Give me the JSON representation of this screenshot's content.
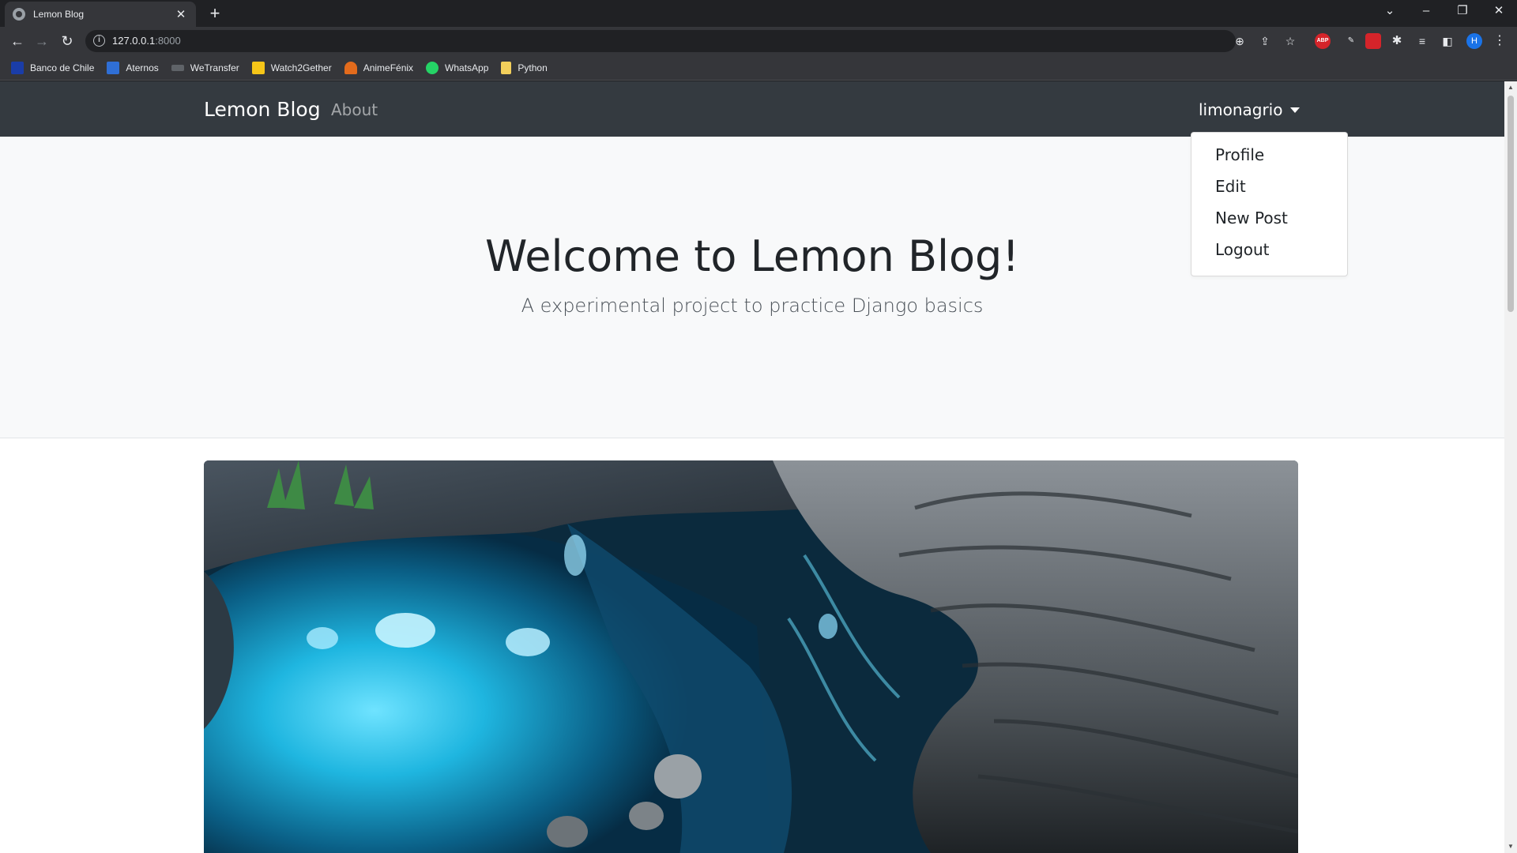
{
  "browser": {
    "tab_title": "Lemon Blog",
    "tab_close": "✕",
    "new_tab": "+",
    "url_host": "127.0.0.1",
    "url_port": ":8000",
    "profile_initial": "H",
    "abp_label": "ABP",
    "bookmarks": [
      {
        "label": "Banco de Chile",
        "icon": "bank-icon",
        "color": "#1a3da8"
      },
      {
        "label": "Aternos",
        "icon": "aternos-icon",
        "color": "#2f6fd6"
      },
      {
        "label": "WeTransfer",
        "icon": "wetransfer-icon",
        "color": "#202124"
      },
      {
        "label": "Watch2Gether",
        "icon": "watch2gether-icon",
        "color": "#f5c518"
      },
      {
        "label": "AnimeFénix",
        "icon": "animefenix-icon",
        "color": "#e36b1c"
      },
      {
        "label": "WhatsApp",
        "icon": "whatsapp-icon",
        "color": "#25d366"
      },
      {
        "label": "Python",
        "icon": "folder-icon",
        "color": "#f2cf5b"
      }
    ]
  },
  "site": {
    "brand": "Lemon Blog",
    "nav_about": "About",
    "username": "limonagrio",
    "dropdown": [
      "Profile",
      "Edit",
      "New Post",
      "Logout"
    ],
    "hero_title": "Welcome to Lemon Blog!",
    "hero_subtitle": "A experimental project to practice Django basics"
  },
  "colors": {
    "navbar": "#343a40",
    "jumbotron": "#f8f9fa",
    "water": "#1fb6e0"
  }
}
